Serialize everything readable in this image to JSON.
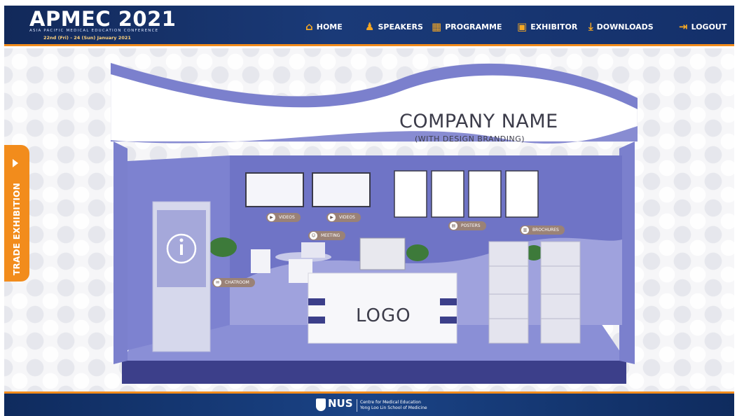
{
  "header": {
    "logo_title": "APMEC 2021",
    "logo_subtitle": "ASIA PACIFIC MEDICAL EDUCATION CONFERENCE",
    "logo_dates": "22nd (Fri) - 24 (Sun) January 2021",
    "nav": {
      "home": "HOME",
      "speakers": "SPEAKERS",
      "programme": "PROGRAMME",
      "exhibitor": "EXHIBITOR",
      "downloads": "DOWNLOADS",
      "logout": "LOGOUT"
    },
    "colors": {
      "bar": "#14306a",
      "accent": "#f28c1c",
      "icon": "#f6a823"
    }
  },
  "side_tab": {
    "label": "TRADE EXHIBITION",
    "color": "#f28c1c"
  },
  "booth": {
    "company_name": "COMPANY NAME",
    "company_sub": "(WITH DESIGN BRANDING)",
    "counter_logo": "LOGO",
    "hotspots": {
      "videos_1": "VIDEOS",
      "videos_2": "VIDEOS",
      "meeting": "MEETING",
      "posters": "POSTERS",
      "brochures": "BROCHURES",
      "chatroom": "CHATROOM"
    },
    "colors": {
      "wall": "#6f74c6",
      "floor": "#8a8fd6",
      "base": "#3c3f8a"
    }
  },
  "footer": {
    "brand": "NUS",
    "line1": "Centre for Medical Education",
    "line2": "Yong Loo Lin School of Medicine"
  }
}
